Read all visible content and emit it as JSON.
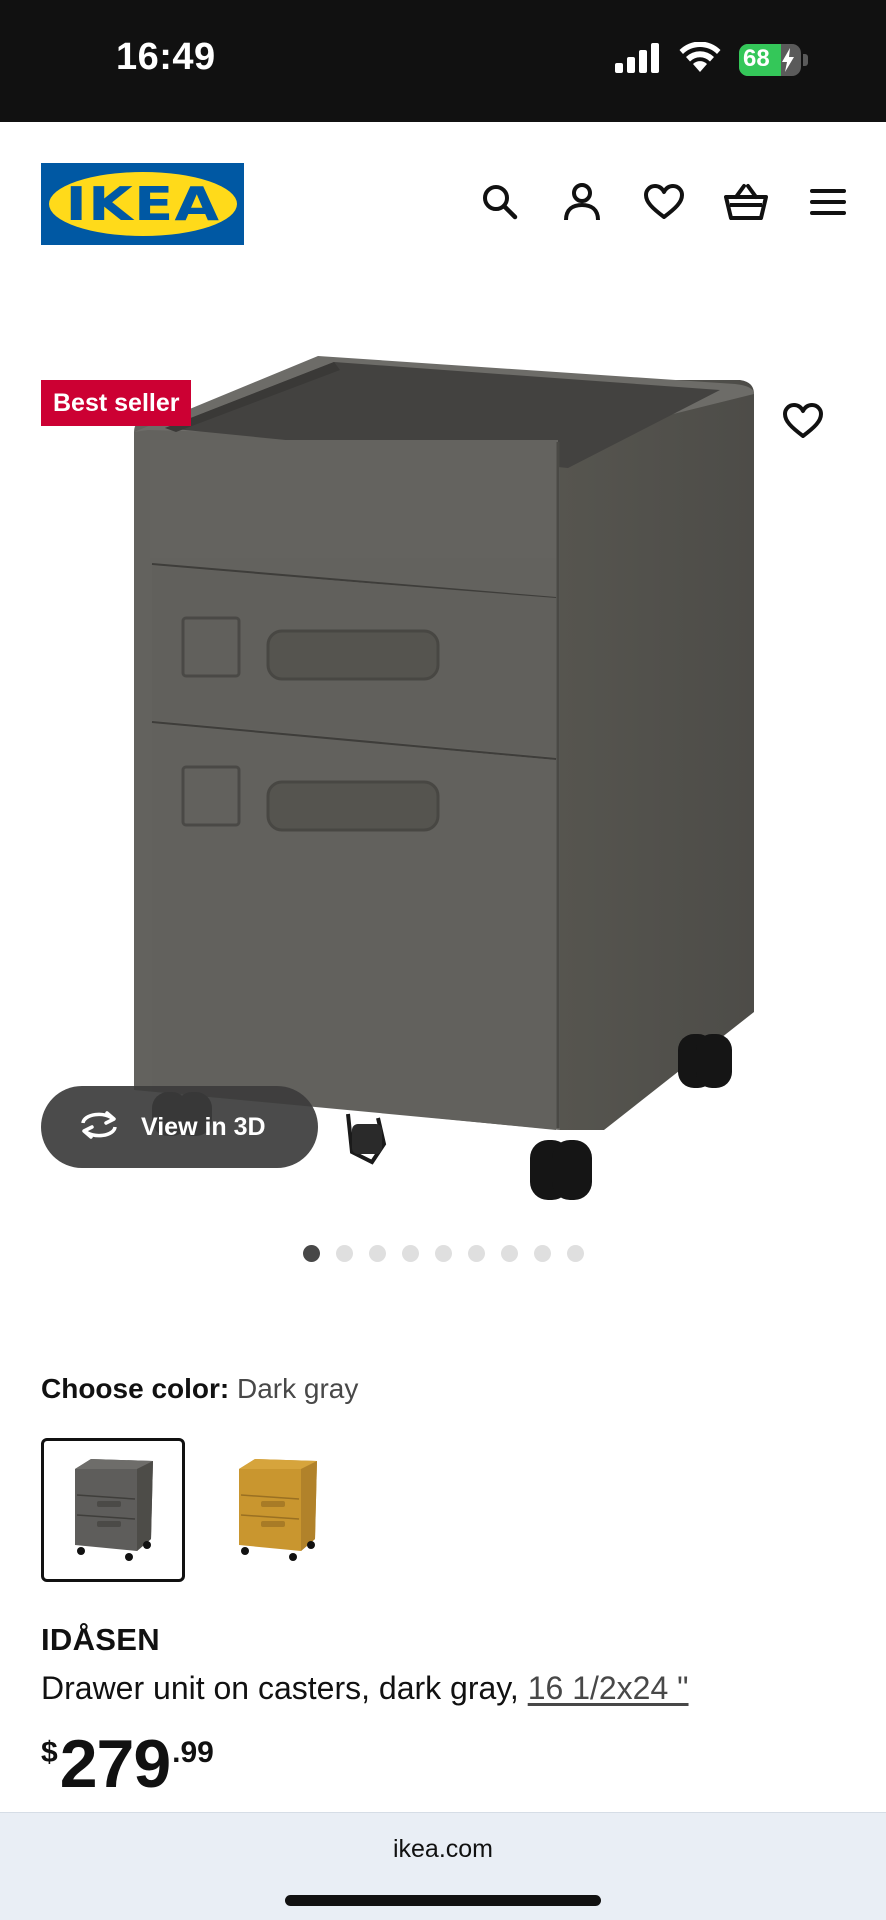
{
  "status_bar": {
    "time": "16:49",
    "battery_percent": "68",
    "battery_level": 0.68,
    "icons": [
      "cellular-signal-icon",
      "wifi-icon",
      "battery-charging-icon"
    ]
  },
  "header": {
    "logo_text": "IKEA",
    "icons": [
      "search-icon",
      "account-icon",
      "wishlist-icon",
      "basket-icon",
      "menu-icon"
    ]
  },
  "product_image": {
    "badge": "Best seller",
    "view_3d_label": "View in 3D",
    "carousel": {
      "total": 9,
      "active_index": 0
    }
  },
  "color_selector": {
    "label": "Choose color:",
    "selected_value": "Dark gray",
    "options": [
      {
        "name": "dark-gray",
        "color": "#5e5d5b",
        "selected": true
      },
      {
        "name": "yellow",
        "color": "#c9962f",
        "selected": false
      }
    ]
  },
  "product": {
    "name": "IDÅSEN",
    "description": "Drawer unit on casters, dark gray, ",
    "size_link": "16 1/2x24 \"",
    "price": {
      "currency": "$",
      "integer": "279",
      "decimal": ".99"
    }
  },
  "browser": {
    "url": "ikea.com"
  },
  "colors": {
    "ikea_blue": "#0058a3",
    "ikea_yellow": "#ffda1a",
    "badge_red": "#cc0033",
    "product_gray": "#5e5d5b"
  }
}
